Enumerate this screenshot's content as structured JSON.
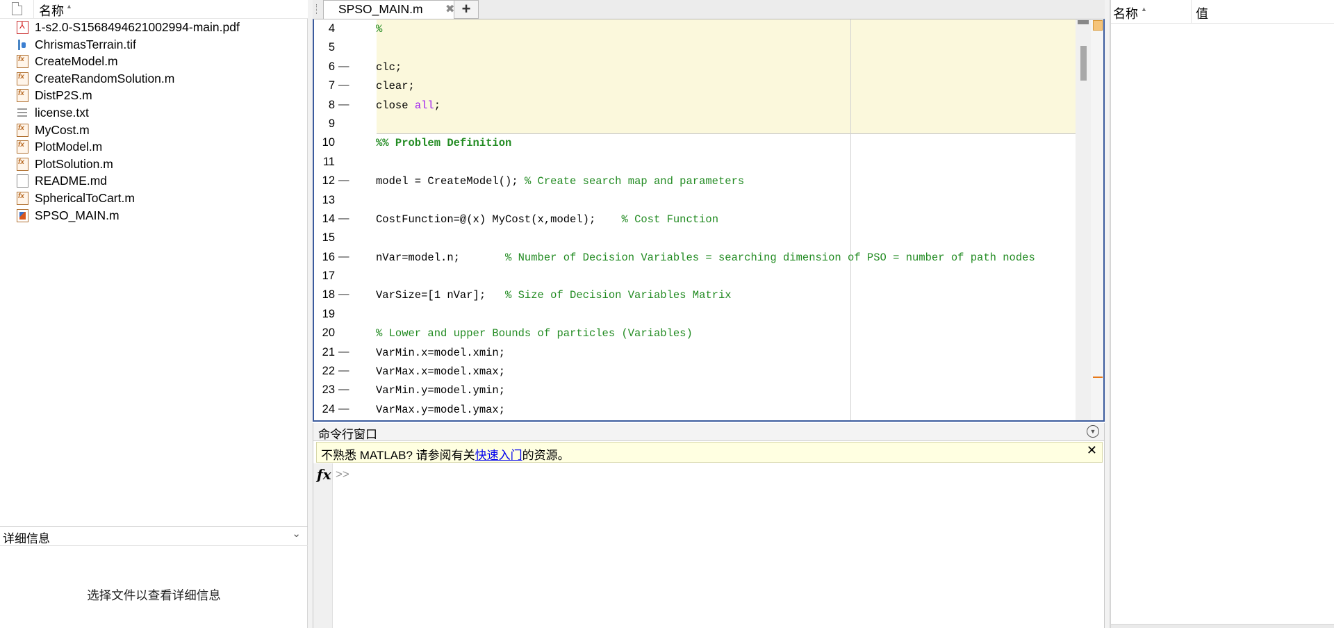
{
  "file_browser": {
    "header": {
      "name_col": "名称",
      "sort_icon": "sort-ascending-icon"
    },
    "files": [
      {
        "name": "1-s2.0-S1568494621002994-main.pdf",
        "icon": "pdf-file-icon"
      },
      {
        "name": "ChrismasTerrain.tif",
        "icon": "image-file-icon"
      },
      {
        "name": "CreateModel.m",
        "icon": "matlab-function-icon"
      },
      {
        "name": "CreateRandomSolution.m",
        "icon": "matlab-function-icon"
      },
      {
        "name": "DistP2S.m",
        "icon": "matlab-function-icon"
      },
      {
        "name": "license.txt",
        "icon": "text-file-icon"
      },
      {
        "name": "MyCost.m",
        "icon": "matlab-function-icon"
      },
      {
        "name": "PlotModel.m",
        "icon": "matlab-function-icon"
      },
      {
        "name": "PlotSolution.m",
        "icon": "matlab-function-icon"
      },
      {
        "name": "README.md",
        "icon": "document-icon"
      },
      {
        "name": "SphericalToCart.m",
        "icon": "matlab-function-icon"
      },
      {
        "name": "SPSO_MAIN.m",
        "icon": "matlab-script-icon"
      }
    ],
    "details": {
      "title": "详细信息",
      "message": "选择文件以查看详细信息"
    }
  },
  "editor": {
    "tab_label": "SPSO_MAIN.m",
    "close_glyph": "✖",
    "add_glyph": "+",
    "lines": [
      {
        "n": "4",
        "dash": "",
        "parts": [
          {
            "t": "%",
            "c": "cmt"
          }
        ]
      },
      {
        "n": "5",
        "dash": "",
        "parts": []
      },
      {
        "n": "6",
        "dash": "—",
        "parts": [
          {
            "t": "clc;",
            "c": ""
          }
        ]
      },
      {
        "n": "7",
        "dash": "—",
        "parts": [
          {
            "t": "clear;",
            "c": ""
          }
        ]
      },
      {
        "n": "8",
        "dash": "—",
        "parts": [
          {
            "t": "close ",
            "c": ""
          },
          {
            "t": "all",
            "c": "kw"
          },
          {
            "t": ";",
            "c": ""
          }
        ]
      },
      {
        "n": "9",
        "dash": "",
        "parts": []
      },
      {
        "n": "10",
        "dash": "",
        "parts": [
          {
            "t": "%% Problem Definition",
            "c": "sec"
          }
        ]
      },
      {
        "n": "11",
        "dash": "",
        "parts": []
      },
      {
        "n": "12",
        "dash": "—",
        "parts": [
          {
            "t": "model = CreateModel(); ",
            "c": ""
          },
          {
            "t": "% Create search map and parameters",
            "c": "cmt"
          }
        ]
      },
      {
        "n": "13",
        "dash": "",
        "parts": []
      },
      {
        "n": "14",
        "dash": "—",
        "parts": [
          {
            "t": "CostFunction=@(x) MyCost(x,model);    ",
            "c": ""
          },
          {
            "t": "% Cost Function",
            "c": "cmt"
          }
        ]
      },
      {
        "n": "15",
        "dash": "",
        "parts": []
      },
      {
        "n": "16",
        "dash": "—",
        "parts": [
          {
            "t": "nVar=model.n;       ",
            "c": ""
          },
          {
            "t": "% Number of Decision Variables = searching dimension of PSO = number of path nodes",
            "c": "cmt"
          }
        ]
      },
      {
        "n": "17",
        "dash": "",
        "parts": []
      },
      {
        "n": "18",
        "dash": "—",
        "parts": [
          {
            "t": "VarSize=[1 nVar];   ",
            "c": ""
          },
          {
            "t": "% Size of Decision Variables Matrix",
            "c": "cmt"
          }
        ]
      },
      {
        "n": "19",
        "dash": "",
        "parts": []
      },
      {
        "n": "20",
        "dash": "",
        "parts": [
          {
            "t": "% Lower and upper Bounds of particles (Variables)",
            "c": "cmt"
          }
        ]
      },
      {
        "n": "21",
        "dash": "—",
        "parts": [
          {
            "t": "VarMin.x=model.xmin;",
            "c": ""
          }
        ]
      },
      {
        "n": "22",
        "dash": "—",
        "parts": [
          {
            "t": "VarMax.x=model.xmax;",
            "c": ""
          }
        ]
      },
      {
        "n": "23",
        "dash": "—",
        "parts": [
          {
            "t": "VarMin.y=model.ymin;",
            "c": ""
          }
        ]
      },
      {
        "n": "24",
        "dash": "—",
        "parts": [
          {
            "t": "VarMax.y=model.ymax;",
            "c": ""
          }
        ]
      }
    ]
  },
  "command_window": {
    "title": "命令行窗口",
    "notice": {
      "prefix": "不熟悉 MATLAB? 请参阅有关",
      "link": "快速入门",
      "suffix": "的资源。",
      "close_glyph": "✕"
    },
    "fx": "fx",
    "prompt": ">>"
  },
  "workspace": {
    "name_col": "名称",
    "value_col": "值"
  }
}
